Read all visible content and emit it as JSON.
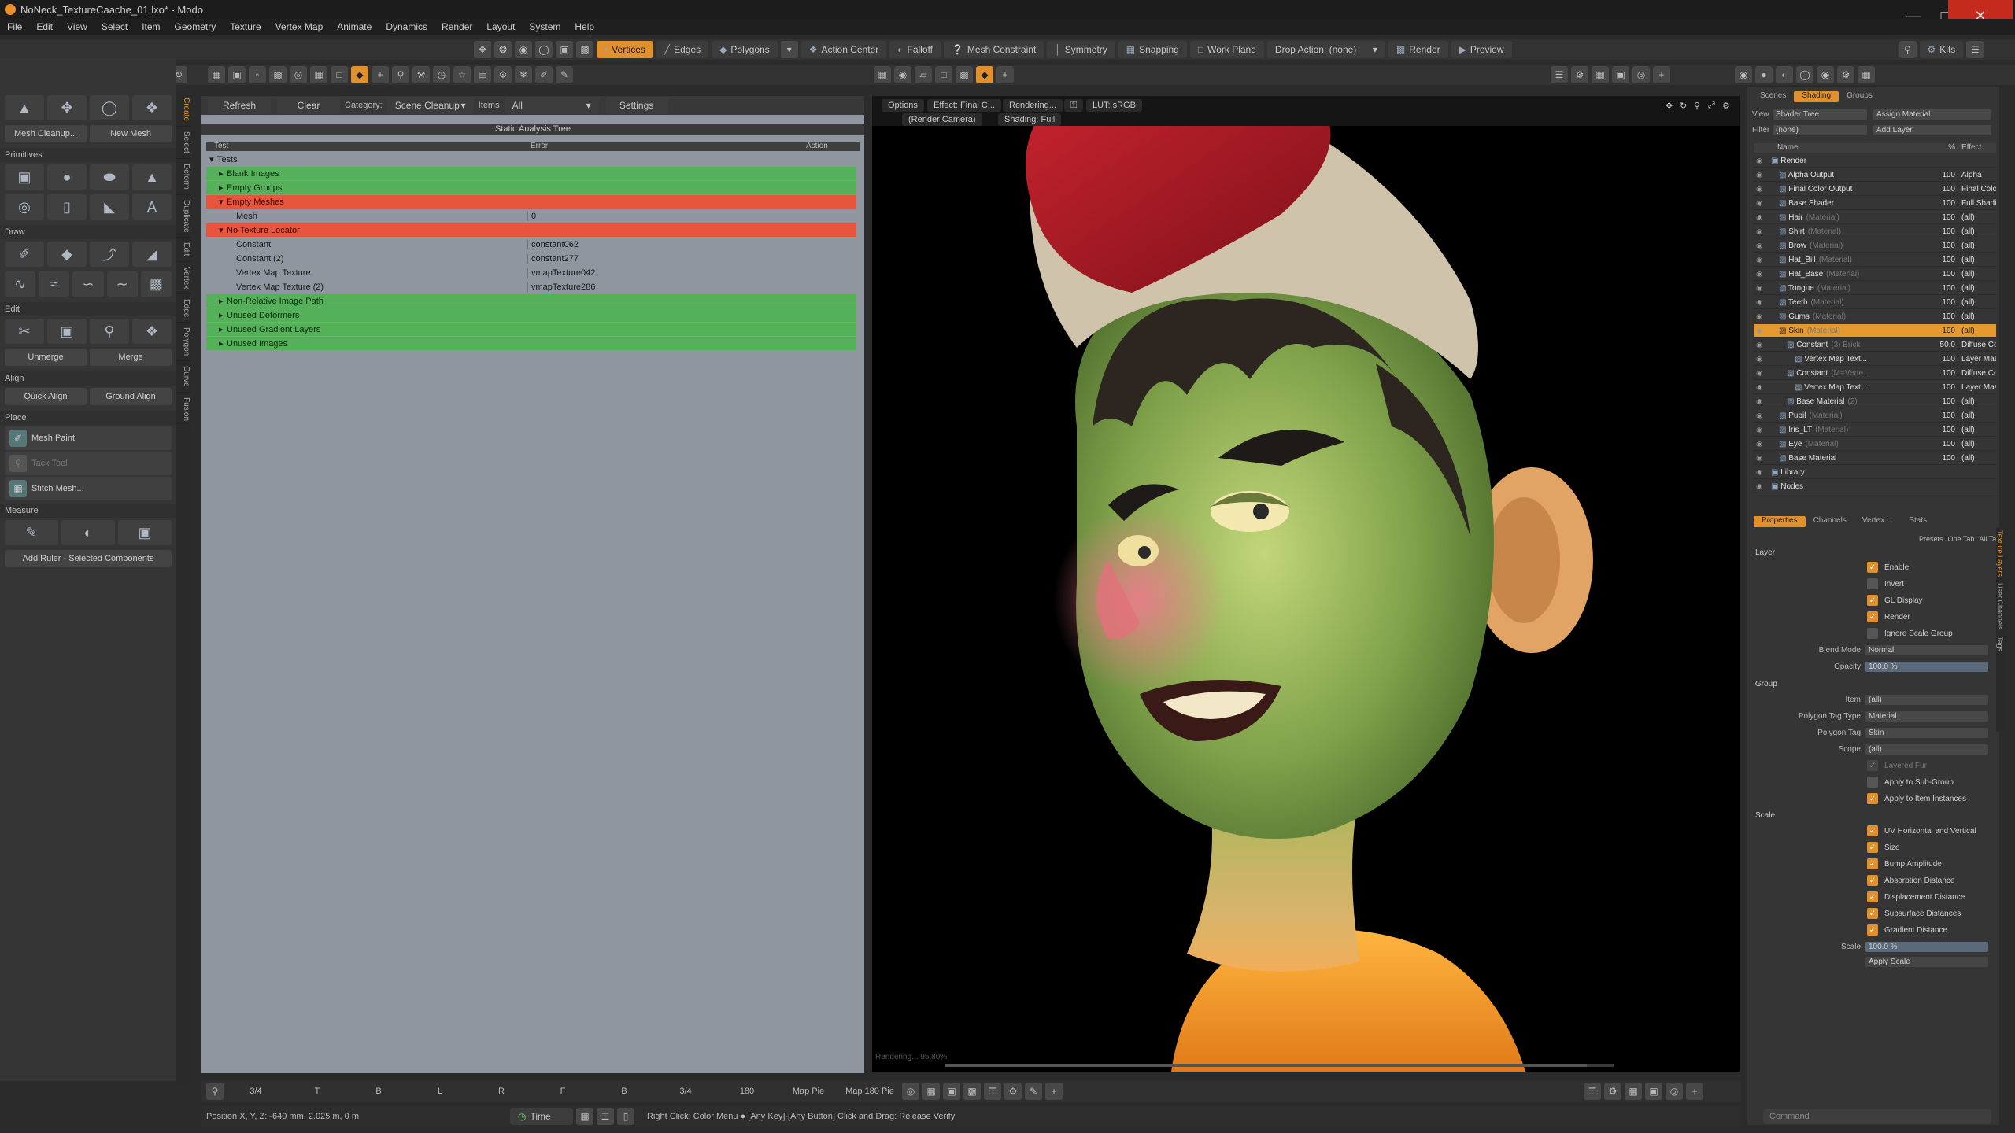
{
  "window": {
    "title": "NoNeck_TextureCaache_01.lxo* - Modo"
  },
  "menu": [
    "File",
    "Edit",
    "View",
    "Select",
    "Item",
    "Geometry",
    "Texture",
    "Vertex Map",
    "Animate",
    "Dynamics",
    "Render",
    "Layout",
    "System",
    "Help"
  ],
  "toolbar": {
    "modes": [
      "Vertices",
      "Edges",
      "Polygons"
    ],
    "action_center": "Action Center",
    "falloff": "Falloff",
    "mesh_constraint": "Mesh Constraint",
    "symmetry": "Symmetry",
    "snapping": "Snapping",
    "work_plane": "Work Plane",
    "drop_action": "Drop Action: (none)",
    "render": "Render",
    "preview": "Preview",
    "kits": "Kits"
  },
  "toolbox": {
    "btn_mesh_cleanup": "Mesh Cleanup...",
    "btn_new_mesh": "New Mesh",
    "sec_primitives": "Primitives",
    "sec_draw": "Draw",
    "sec_edit": "Edit",
    "btn_unmerge": "Unmerge",
    "btn_merge": "Merge",
    "sec_align": "Align",
    "btn_quick_align": "Quick Align",
    "btn_ground_align": "Ground Align",
    "sec_place": "Place",
    "btn_mesh_paint": "Mesh Paint",
    "btn_tack_tool": "Tack Tool",
    "btn_stitch_mesh": "Stitch Mesh...",
    "sec_measure": "Measure",
    "btn_add_ruler": "Add Ruler - Selected Components",
    "vtabs": [
      "Create",
      "Select",
      "Deform",
      "Duplicate",
      "Edit",
      "Vertex",
      "Edge",
      "Polygon",
      "Curve",
      "Fusion"
    ]
  },
  "analysis": {
    "refresh": "Refresh",
    "clear": "Clear",
    "category_label": "Category:",
    "category": "Scene Cleanup",
    "items_label": "Items",
    "items": "All",
    "settings": "Settings",
    "title": "Static Analysis Tree",
    "col_test": "Test",
    "col_error": "Error",
    "col_action": "Action",
    "rows": [
      {
        "label": "Tests",
        "error": "",
        "level": 0,
        "state": "none"
      },
      {
        "label": "Blank Images",
        "error": "",
        "level": 1,
        "state": "green"
      },
      {
        "label": "Empty Groups",
        "error": "",
        "level": 1,
        "state": "green"
      },
      {
        "label": "Empty Meshes",
        "error": "",
        "level": 1,
        "state": "red"
      },
      {
        "label": "Mesh",
        "error": "0",
        "level": 2,
        "state": "none"
      },
      {
        "label": "No Texture Locator",
        "error": "",
        "level": 1,
        "state": "red"
      },
      {
        "label": "Constant",
        "error": "constant062",
        "level": 2,
        "state": "none"
      },
      {
        "label": "Constant (2)",
        "error": "constant277",
        "level": 2,
        "state": "none"
      },
      {
        "label": "Vertex Map Texture",
        "error": "vmapTexture042",
        "level": 2,
        "state": "none"
      },
      {
        "label": "Vertex Map Texture (2)",
        "error": "vmapTexture286",
        "level": 2,
        "state": "none"
      },
      {
        "label": "Non-Relative Image Path",
        "error": "",
        "level": 1,
        "state": "green"
      },
      {
        "label": "Unused Deformers",
        "error": "",
        "level": 1,
        "state": "green"
      },
      {
        "label": "Unused Gradient Layers",
        "error": "",
        "level": 1,
        "state": "green"
      },
      {
        "label": "Unused Images",
        "error": "",
        "level": 1,
        "state": "green"
      }
    ]
  },
  "viewport": {
    "options": "Options",
    "effect": "Effect: Final C...",
    "rendering": "Rendering...",
    "lut": "LUT: sRGB",
    "camera": "(Render Camera)",
    "shading": "Shading: Full",
    "progress": "Rendering... 95.80%"
  },
  "bottom": {
    "items": [
      "3/4",
      "T",
      "B",
      "L",
      "R",
      "F",
      "B",
      "3/4",
      "180",
      "Map Pie",
      "Map 180 Pie"
    ],
    "position": "Position X, Y, Z:  -640 mm, 2.025 m, 0 m",
    "time": "Time",
    "hint": "Right Click: Color Menu ●  [Any Key]-[Any Button] Click and Drag: Release Verify"
  },
  "shading": {
    "tabs": [
      "Scenes",
      "Shading",
      "Groups"
    ],
    "view_label": "View",
    "view": "Shader Tree",
    "assign_material": "Assign Material",
    "filter_label": "Filter",
    "filter": "(none)",
    "add_layer": "Add Layer",
    "col_name": "Name",
    "col_pct": "%",
    "col_effect": "Effect",
    "rows": [
      {
        "name": "Render",
        "tag": "",
        "pct": "",
        "effect": "",
        "level": 0
      },
      {
        "name": "Alpha Output",
        "tag": "",
        "pct": "100",
        "effect": "Alpha",
        "level": 1
      },
      {
        "name": "Final Color Output",
        "tag": "",
        "pct": "100",
        "effect": "Final Color",
        "level": 1
      },
      {
        "name": "Base Shader",
        "tag": "",
        "pct": "100",
        "effect": "Full Shading",
        "level": 1
      },
      {
        "name": "Hair",
        "tag": "(Material)",
        "pct": "100",
        "effect": "(all)",
        "level": 1
      },
      {
        "name": "Shirt",
        "tag": "(Material)",
        "pct": "100",
        "effect": "(all)",
        "level": 1
      },
      {
        "name": "Brow",
        "tag": "(Material)",
        "pct": "100",
        "effect": "(all)",
        "level": 1
      },
      {
        "name": "Hat_Bill",
        "tag": "(Material)",
        "pct": "100",
        "effect": "(all)",
        "level": 1
      },
      {
        "name": "Hat_Base",
        "tag": "(Material)",
        "pct": "100",
        "effect": "(all)",
        "level": 1
      },
      {
        "name": "Tongue",
        "tag": "(Material)",
        "pct": "100",
        "effect": "(all)",
        "level": 1
      },
      {
        "name": "Teeth",
        "tag": "(Material)",
        "pct": "100",
        "effect": "(all)",
        "level": 1
      },
      {
        "name": "Gums",
        "tag": "(Material)",
        "pct": "100",
        "effect": "(all)",
        "level": 1
      },
      {
        "name": "Skin",
        "tag": "(Material)",
        "pct": "100",
        "effect": "(all)",
        "level": 1,
        "hl": true
      },
      {
        "name": "Constant",
        "tag": "(3) Brick",
        "pct": "50.0",
        "effect": "Diffuse Color",
        "level": 2
      },
      {
        "name": "Vertex Map Text...",
        "tag": "",
        "pct": "100",
        "effect": "Layer Mask",
        "level": 3
      },
      {
        "name": "Constant",
        "tag": "(M=Verte...",
        "pct": "100",
        "effect": "Diffuse Color",
        "level": 2
      },
      {
        "name": "Vertex Map Text...",
        "tag": "",
        "pct": "100",
        "effect": "Layer Mask",
        "level": 3
      },
      {
        "name": "Base Material",
        "tag": "(2)",
        "pct": "100",
        "effect": "(all)",
        "level": 2
      },
      {
        "name": "Pupil",
        "tag": "(Material)",
        "pct": "100",
        "effect": "(all)",
        "level": 1
      },
      {
        "name": "Iris_LT",
        "tag": "(Material)",
        "pct": "100",
        "effect": "(all)",
        "level": 1
      },
      {
        "name": "Eye",
        "tag": "(Material)",
        "pct": "100",
        "effect": "(all)",
        "level": 1
      },
      {
        "name": "Base Material",
        "tag": "",
        "pct": "100",
        "effect": "(all)",
        "level": 1
      },
      {
        "name": "Library",
        "tag": "",
        "pct": "",
        "effect": "",
        "level": 0
      },
      {
        "name": "Nodes",
        "tag": "",
        "pct": "",
        "effect": "",
        "level": 0
      }
    ]
  },
  "properties": {
    "tabs": [
      "Properties",
      "Channels",
      "Vertex ...",
      "Stats"
    ],
    "presets": "Presets",
    "one_tab": "One Tab",
    "all_tabs": "All Tabs",
    "sec_layer": "Layer",
    "enable": "Enable",
    "invert": "Invert",
    "gl_display": "GL Display",
    "render": "Render",
    "ignore_scale_group": "Ignore Scale Group",
    "blend_mode_label": "Blend Mode",
    "blend_mode": "Normal",
    "opacity_label": "Opacity",
    "opacity": "100.0 %",
    "sec_group": "Group",
    "item_label": "Item",
    "item": "(all)",
    "ptag_type_label": "Polygon Tag Type",
    "ptag_type": "Material",
    "ptag_label": "Polygon Tag",
    "ptag": "Skin",
    "scope_label": "Scope",
    "scope": "(all)",
    "layered_fur": "Layered Fur",
    "apply_sub_group": "Apply to Sub-Group",
    "apply_instances": "Apply to Item Instances",
    "sec_scale": "Scale",
    "uv_hv": "UV Horizontal and Vertical",
    "size": "Size",
    "bump_amplitude": "Bump Amplitude",
    "absorption_distance": "Absorption Distance",
    "displacement_distance": "Displacement Distance",
    "subsurface_distances": "Subsurface Distances",
    "gradient_distance": "Gradient Distance",
    "scale_label": "Scale",
    "scale": "100.0 %",
    "apply_scale": "Apply Scale",
    "side_tabs": [
      "Texture Layers",
      "User Channels",
      "Tags"
    ]
  },
  "command": {
    "placeholder": "Command"
  }
}
